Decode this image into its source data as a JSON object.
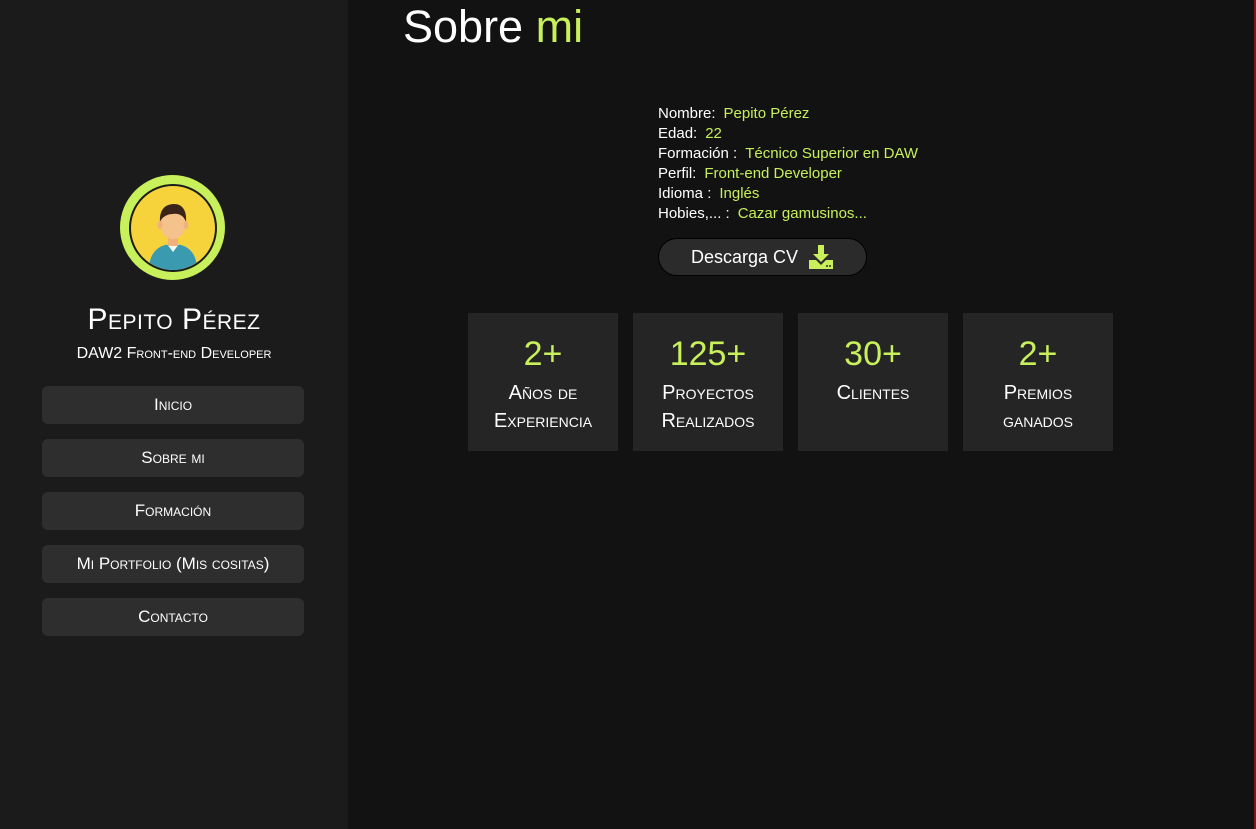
{
  "sidebar": {
    "name": "Pepito Pérez",
    "role": "DAW2 Front-end Developer",
    "nav": [
      {
        "label": "Inicio"
      },
      {
        "label": "Sobre mi"
      },
      {
        "label": "Formación"
      },
      {
        "label": "Mi Portfolio (Mis cositas)"
      },
      {
        "label": "Contacto"
      }
    ]
  },
  "main": {
    "title_main": "Sobre",
    "title_accent": "mi",
    "info": [
      {
        "label": "Nombre:",
        "value": "Pepito Pérez"
      },
      {
        "label": "Edad:",
        "value": "22"
      },
      {
        "label": "Formación :",
        "value": "Técnico Superior en DAW"
      },
      {
        "label": "Perfil:",
        "value": "Front-end Developer"
      },
      {
        "label": "Idioma :",
        "value": "Inglés"
      },
      {
        "label": "Hobies,... :",
        "value": "Cazar gamusinos..."
      }
    ],
    "cv_button": "Descarga CV",
    "stats": [
      {
        "number": "2+",
        "label": "Años de Experiencia"
      },
      {
        "number": "125+",
        "label": "Proyectos Realizados"
      },
      {
        "number": "30+",
        "label": "Clientes"
      },
      {
        "number": "2+",
        "label": "Premios ganados"
      }
    ]
  },
  "colors": {
    "accent": "#c7f05a",
    "background": "#121212",
    "sidebar": "#1b1b1b",
    "card": "#252525"
  },
  "icons": {
    "download": "download-icon",
    "avatar": "user-avatar"
  }
}
